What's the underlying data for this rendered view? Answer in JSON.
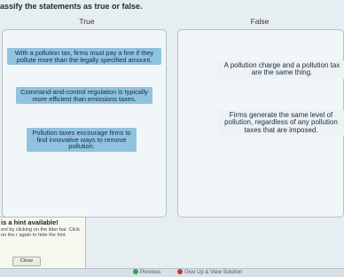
{
  "instruction": "assify the statements as true or false.",
  "columns": {
    "true_label": "True",
    "false_label": "False"
  },
  "true_cards": [
    "With a pollution tax, firms must pay a fine if they pollute more than the legally specified amount.",
    "Command-and-control regulation is typically more efficient than emissions taxes.",
    "Pollution taxes encourage firms to find innovative ways to remove pollution."
  ],
  "false_cards": [
    "A pollution charge and a pollution tax are the same thing.",
    "Firms generate the same level of pollution, regardless of any pollution taxes that are imposed."
  ],
  "hint": {
    "title": "is a hint available!",
    "body": "ent by clicking on the ilder bar. Click on the r again to hide the hint.",
    "close_label": "Close"
  },
  "bottom_bar": {
    "previous_label": "Previous",
    "give_up_label": "Give Up & View Solution",
    "colors": {
      "previous": "#3aa04a",
      "give_up": "#d0342c"
    },
    "icons": {
      "previous": "previous-icon",
      "give_up": "give-up-icon"
    }
  }
}
